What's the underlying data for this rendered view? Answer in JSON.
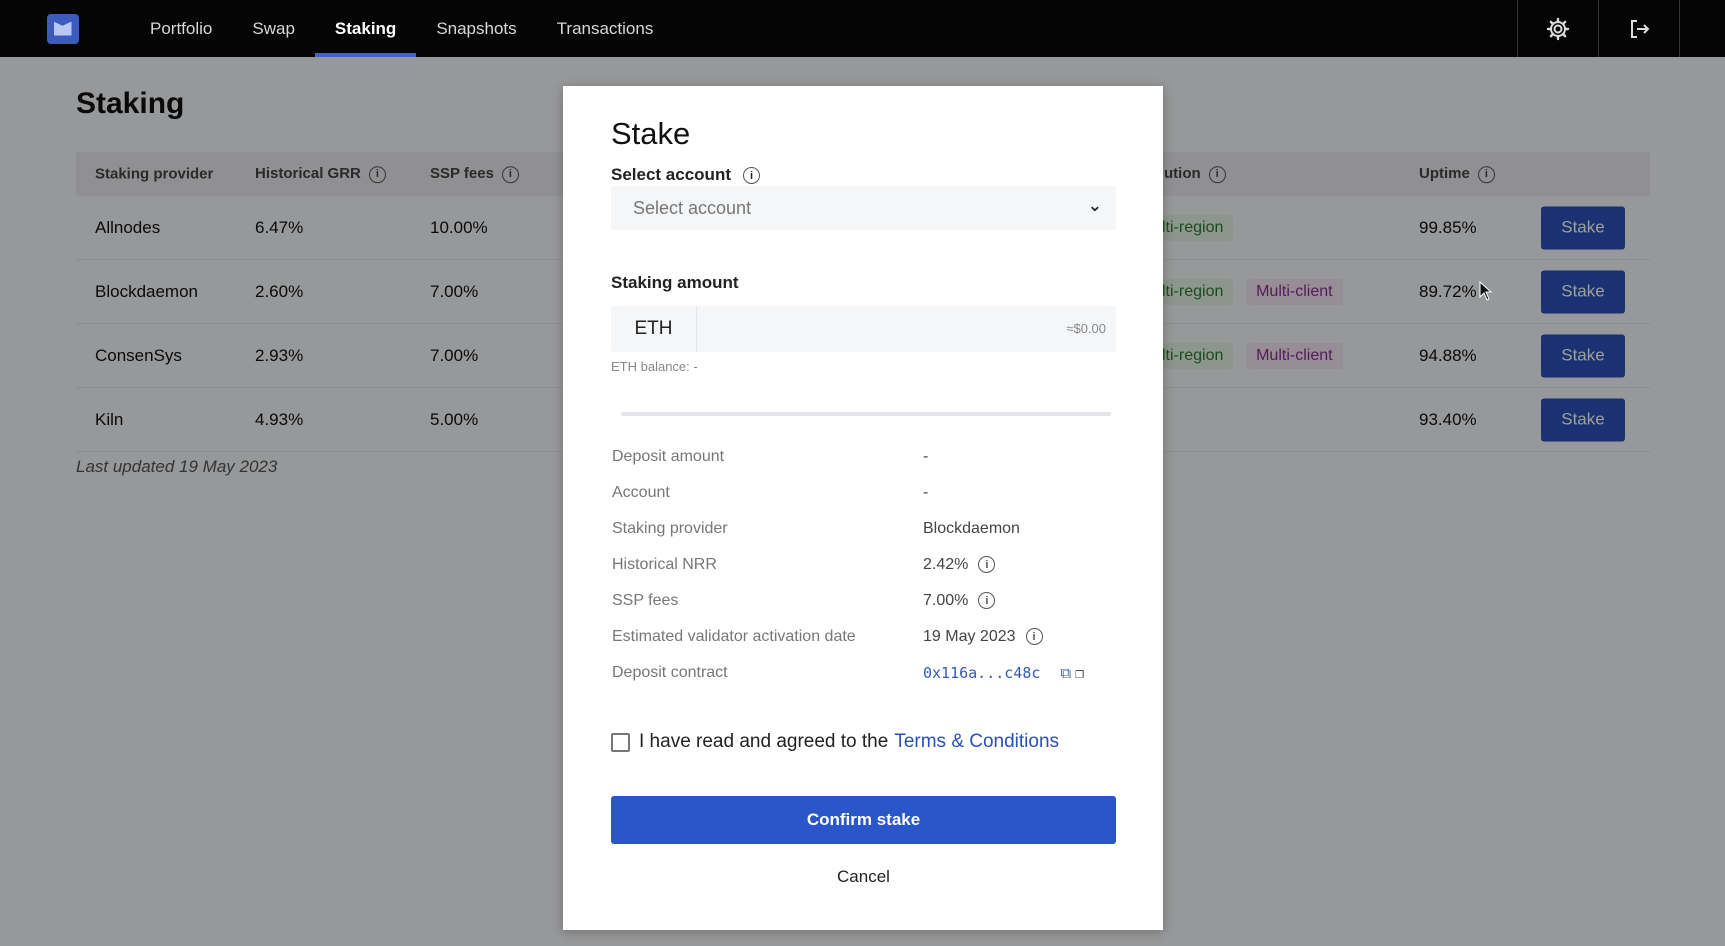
{
  "nav": {
    "links": [
      "Portfolio",
      "Swap",
      "Staking",
      "Snapshots",
      "Transactions"
    ],
    "active": "Staking",
    "icons": [
      "gear-icon",
      "logout-icon"
    ]
  },
  "page": {
    "title": "Staking",
    "columns": {
      "provider": "Staking provider",
      "grr": "Historical GRR",
      "fees": "SSP fees",
      "distribution": "ution",
      "uptime": "Uptime"
    },
    "rows": [
      {
        "provider": "Allnodes",
        "grr": "6.47%",
        "fees": "10.00%",
        "tag1": "lti-region",
        "tag2": "",
        "uptime": "99.85%",
        "action": "Stake"
      },
      {
        "provider": "Blockdaemon",
        "grr": "2.60%",
        "fees": "7.00%",
        "tag1": "lti-region",
        "tag2": "Multi-client",
        "uptime": "89.72%",
        "action": "Stake"
      },
      {
        "provider": "ConsenSys",
        "grr": "2.93%",
        "fees": "7.00%",
        "tag1": "lti-region",
        "tag2": "Multi-client",
        "uptime": "94.88%",
        "action": "Stake"
      },
      {
        "provider": "Kiln",
        "grr": "4.93%",
        "fees": "5.00%",
        "tag1": "",
        "tag2": "",
        "uptime": "93.40%",
        "action": "Stake"
      }
    ],
    "last_updated": "Last updated 19 May 2023"
  },
  "modal": {
    "title": "Stake",
    "select_account_label": "Select account",
    "select_account_placeholder": "Select account",
    "staking_amount_label": "Staking amount",
    "currency": "ETH",
    "usd_value": "≈$0.00",
    "eth_balance": "ETH balance: -",
    "details": [
      {
        "key": "Deposit amount",
        "value": "-"
      },
      {
        "key": "Account",
        "value": "-"
      },
      {
        "key": "Staking provider",
        "value": "Blockdaemon"
      },
      {
        "key": "Historical NRR",
        "value": "2.42%"
      },
      {
        "key": "SSP fees",
        "value": "7.00%"
      },
      {
        "key": "Estimated validator activation date",
        "value": "19 May 2023"
      },
      {
        "key": "Deposit contract",
        "value": "0x116a...c48c"
      }
    ],
    "agree_text": "I have read and agreed to the",
    "terms_link": "Terms & Conditions",
    "confirm_label": "Confirm stake",
    "cancel_label": "Cancel"
  },
  "colors": {
    "primary": "#2a56c9",
    "nav_bg": "#050505",
    "tag_green": "#2e7a35",
    "tag_purple": "#8a2f8f"
  }
}
